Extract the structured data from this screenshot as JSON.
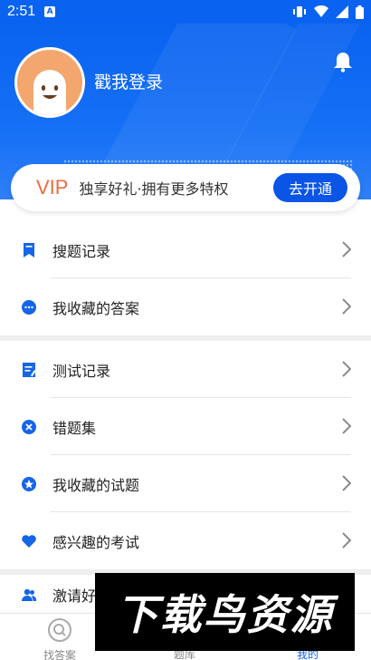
{
  "status_bar": {
    "time": "2:51",
    "notification_badge": "A"
  },
  "header": {
    "login_text": "戳我登录"
  },
  "vip": {
    "label": "VIP",
    "description": "独享好礼·拥有更多特权",
    "button": "去开通"
  },
  "section1": [
    {
      "label": "搜题记录",
      "icon": "bookmark-icon"
    },
    {
      "label": "我收藏的答案",
      "icon": "chat-bubble-icon"
    }
  ],
  "section2": [
    {
      "label": "测试记录",
      "icon": "document-edit-icon"
    },
    {
      "label": "错题集",
      "icon": "x-circle-icon"
    },
    {
      "label": "我收藏的试题",
      "icon": "star-circle-icon"
    },
    {
      "label": "感兴趣的考试",
      "icon": "heart-icon"
    }
  ],
  "section3": [
    {
      "label": "激请好",
      "icon": "users-icon"
    }
  ],
  "bottom_nav": {
    "find_answer": "找答案",
    "question_bank": "题库",
    "mine": "我的"
  },
  "watermark": "下载鸟资源",
  "colors": {
    "primary": "#0a63f0",
    "vip_orange": "#e96b3d",
    "button_blue": "#0a55e6",
    "icon_blue": "#1565e8"
  }
}
